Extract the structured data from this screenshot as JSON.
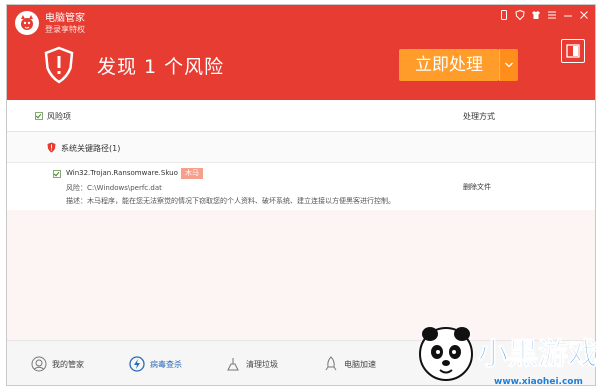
{
  "app": {
    "title": "电脑管家",
    "login": "登录享特权"
  },
  "header": {
    "headline": "发现 1 个风险",
    "primary_button": "立即处理"
  },
  "columns": {
    "risk_item": "风险项",
    "handling": "处理方式"
  },
  "category": {
    "label": "系统关键路径(1)"
  },
  "item": {
    "name": "Win32.Trojan.Ransomware.Skuo",
    "badge": "木马",
    "risk": "风险：C:\\Windows\\perfc.dat",
    "desc": "描述：木马程序，能在您无法察觉的情况下窃取您的个人资料、破坏系统、建立连接以方便黑客进行控制。",
    "action": "删除文件"
  },
  "nav": [
    {
      "label": "我的管家"
    },
    {
      "label": "病毒查杀"
    },
    {
      "label": "清理垃圾"
    },
    {
      "label": "电脑加速"
    }
  ],
  "watermark": {
    "brand": "小黑游戏",
    "url": "www.xiaohei.com"
  },
  "colors": {
    "header": "#e63c32",
    "button": "#ff9c2a",
    "active_nav": "#2a6bb8"
  }
}
